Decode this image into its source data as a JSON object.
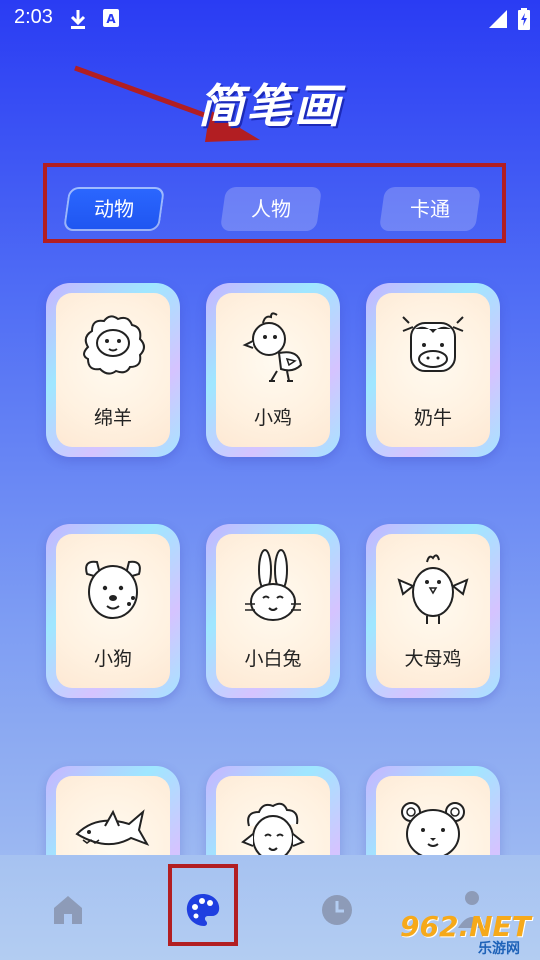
{
  "status_bar": {
    "time": "2:03"
  },
  "header": {
    "title": "简笔画"
  },
  "tabs": [
    {
      "label": "动物",
      "active": true
    },
    {
      "label": "人物",
      "active": false
    },
    {
      "label": "卡通",
      "active": false
    }
  ],
  "cards": [
    {
      "label": "绵羊",
      "icon": "sheep-drawing"
    },
    {
      "label": "小鸡",
      "icon": "chick-drawing"
    },
    {
      "label": "奶牛",
      "icon": "cow-drawing"
    },
    {
      "label": "小狗",
      "icon": "dog-drawing"
    },
    {
      "label": "小白兔",
      "icon": "rabbit-drawing"
    },
    {
      "label": "大母鸡",
      "icon": "hen-drawing"
    },
    {
      "label": "",
      "icon": "shark-drawing"
    },
    {
      "label": "",
      "icon": "lamb-drawing"
    },
    {
      "label": "",
      "icon": "bear-drawing"
    }
  ],
  "bottom_nav": [
    {
      "name": "home",
      "icon": "home-icon"
    },
    {
      "name": "palette",
      "icon": "palette-icon",
      "active": true
    },
    {
      "name": "history",
      "icon": "clock-icon"
    },
    {
      "name": "profile",
      "icon": "person-icon"
    }
  ],
  "watermark": {
    "brand": "962.NET",
    "sub": "乐游网"
  },
  "colors": {
    "accent": "#1f55f0",
    "annotation": "#b21e22"
  }
}
